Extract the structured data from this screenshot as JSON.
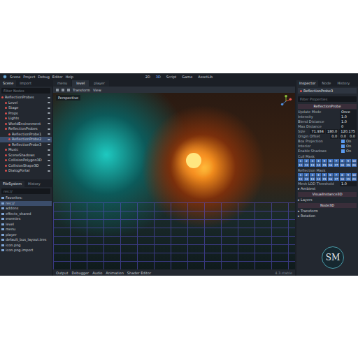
{
  "menu": [
    "Scene",
    "Project",
    "Debug",
    "Editor",
    "Help"
  ],
  "workspaces": [
    {
      "label": "2D",
      "selected": false
    },
    {
      "label": "3D",
      "selected": true
    },
    {
      "label": "Script",
      "selected": false
    },
    {
      "label": "Game",
      "selected": false
    },
    {
      "label": "AssetLib",
      "selected": false
    }
  ],
  "scene_dock": {
    "tabs": [
      {
        "label": "Scene",
        "selected": true
      },
      {
        "label": "Import",
        "selected": false
      }
    ],
    "filter_placeholder": "Filter Nodes",
    "tree": [
      {
        "label": "ReflectionProbes",
        "depth": 0,
        "selected": false
      },
      {
        "label": "Level",
        "depth": 1,
        "selected": false
      },
      {
        "label": "Stage",
        "depth": 1,
        "selected": false
      },
      {
        "label": "Props",
        "depth": 1,
        "selected": false
      },
      {
        "label": "Lights",
        "depth": 1,
        "selected": false
      },
      {
        "label": "WorldEnvironment",
        "depth": 1,
        "selected": false
      },
      {
        "label": "ReflectionProbes",
        "depth": 1,
        "selected": false
      },
      {
        "label": "ReflectionProbe1",
        "depth": 2,
        "selected": false
      },
      {
        "label": "ReflectionProbe2",
        "depth": 2,
        "selected": true
      },
      {
        "label": "ReflectionProbe3",
        "depth": 2,
        "selected": false
      },
      {
        "label": "Music",
        "depth": 1,
        "selected": false
      },
      {
        "label": "SceneShadows",
        "depth": 1,
        "selected": false
      },
      {
        "label": "CollisionPolygon3D",
        "depth": 1,
        "selected": false
      },
      {
        "label": "CollisionShape3D",
        "depth": 1,
        "selected": false
      },
      {
        "label": "DialogPortal",
        "depth": 1,
        "selected": false
      }
    ]
  },
  "filesystem": {
    "tabs": [
      {
        "label": "FileSystem",
        "selected": true
      },
      {
        "label": "History",
        "selected": false
      }
    ],
    "path": "res://",
    "items": [
      {
        "label": "Favorites:",
        "selected": false
      },
      {
        "label": "res://",
        "selected": true
      },
      {
        "label": "addons",
        "selected": false
      },
      {
        "label": "effects_shared",
        "selected": false
      },
      {
        "label": "enemies",
        "selected": false
      },
      {
        "label": "level",
        "selected": false
      },
      {
        "label": "menu",
        "selected": false
      },
      {
        "label": "player",
        "selected": false
      },
      {
        "label": "default_bus_layout.tres",
        "selected": false
      },
      {
        "label": "icon.png",
        "selected": false
      },
      {
        "label": "icon.png.import",
        "selected": false
      }
    ]
  },
  "scene_tabs": [
    {
      "label": "menu",
      "selected": false
    },
    {
      "label": "level",
      "selected": true
    },
    {
      "label": "player",
      "selected": false
    }
  ],
  "viewport": {
    "toolbar": [
      "Transform",
      "View"
    ],
    "label": "Perspective"
  },
  "bottom_tabs": [
    "Output",
    "Debugger",
    "Audio",
    "Animation",
    "Shader Editor"
  ],
  "version": "4.3.stable",
  "inspector": {
    "tabs": [
      {
        "label": "Inspector",
        "selected": true
      },
      {
        "label": "Node",
        "selected": false
      },
      {
        "label": "History",
        "selected": false
      }
    ],
    "node": "ReflectionProbe3",
    "filter_placeholder": "Filter Properties",
    "properties": [
      {
        "kind": "section",
        "label": "ReflectionProbe"
      },
      {
        "kind": "value",
        "label": "Update Mode",
        "value": "Once"
      },
      {
        "kind": "value",
        "label": "Intensity",
        "value": "1.0"
      },
      {
        "kind": "value",
        "label": "Blend Distance",
        "value": "1.0"
      },
      {
        "kind": "value",
        "label": "Max Distance",
        "value": "0"
      },
      {
        "kind": "vector",
        "label": "Size",
        "values": [
          "71.934",
          "180.0",
          "120.175"
        ]
      },
      {
        "kind": "vector",
        "label": "Origin Offset",
        "values": [
          "0.0",
          "0.0",
          "0.0"
        ]
      },
      {
        "kind": "toggle",
        "label": "Box Projection",
        "value": "On",
        "on": true
      },
      {
        "kind": "toggle",
        "label": "Interior",
        "value": "On",
        "on": true
      },
      {
        "kind": "toggle",
        "label": "Enable Shadows",
        "value": "On",
        "on": true
      },
      {
        "kind": "mask",
        "label": "Cull Mask",
        "bits": [
          {
            "n": "1",
            "on": true
          },
          {
            "n": "2",
            "on": true
          },
          {
            "n": "3",
            "on": true
          },
          {
            "n": "4",
            "on": true
          },
          {
            "n": "5",
            "on": true
          },
          {
            "n": "6",
            "on": true
          },
          {
            "n": "7",
            "on": true
          },
          {
            "n": "8",
            "on": true
          },
          {
            "n": "9",
            "on": true
          },
          {
            "n": "10",
            "on": true
          },
          {
            "n": "11",
            "on": true
          },
          {
            "n": "12",
            "on": true
          },
          {
            "n": "13",
            "on": true
          },
          {
            "n": "14",
            "on": true
          },
          {
            "n": "15",
            "on": true
          },
          {
            "n": "16",
            "on": true
          },
          {
            "n": "17",
            "on": true
          },
          {
            "n": "18",
            "on": true
          },
          {
            "n": "19",
            "on": true
          },
          {
            "n": "20",
            "on": true
          }
        ]
      },
      {
        "kind": "mask",
        "label": "Reflection Mask",
        "bits": [
          {
            "n": "1",
            "on": true
          },
          {
            "n": "2",
            "on": true
          },
          {
            "n": "3",
            "on": true
          },
          {
            "n": "4",
            "on": true
          },
          {
            "n": "5",
            "on": true
          },
          {
            "n": "6",
            "on": true
          },
          {
            "n": "7",
            "on": true
          },
          {
            "n": "8",
            "on": true
          },
          {
            "n": "9",
            "on": true
          },
          {
            "n": "10",
            "on": true
          },
          {
            "n": "11",
            "on": true
          },
          {
            "n": "12",
            "on": true
          },
          {
            "n": "13",
            "on": true
          },
          {
            "n": "14",
            "on": true
          },
          {
            "n": "15",
            "on": true
          },
          {
            "n": "16",
            "on": true
          },
          {
            "n": "17",
            "on": true
          },
          {
            "n": "18",
            "on": true
          },
          {
            "n": "19",
            "on": true
          },
          {
            "n": "20",
            "on": true
          }
        ]
      },
      {
        "kind": "value",
        "label": "Mesh LOD Threshold",
        "value": "1.0"
      },
      {
        "kind": "group",
        "label": "Ambient"
      },
      {
        "kind": "section",
        "label": "VisualInstance3D"
      },
      {
        "kind": "group",
        "label": "Layers"
      },
      {
        "kind": "section",
        "label": "Node3D"
      },
      {
        "kind": "group",
        "label": "Transform"
      },
      {
        "kind": "group",
        "label": "Rotation"
      }
    ]
  },
  "watermark": "SM"
}
